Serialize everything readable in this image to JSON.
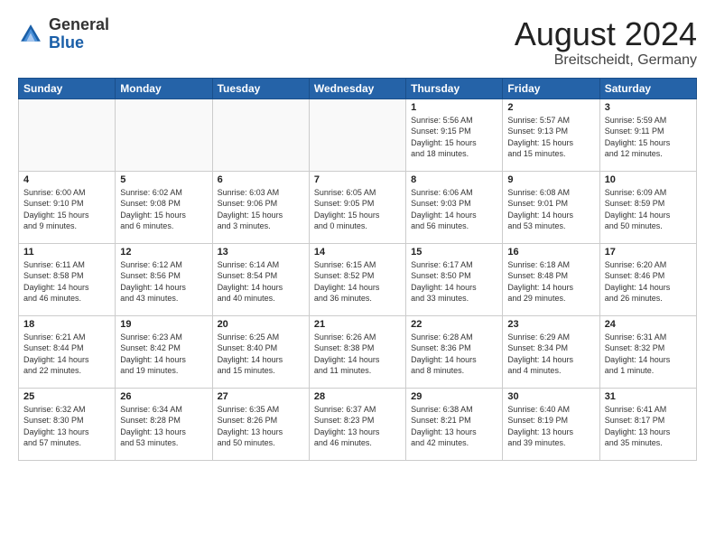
{
  "header": {
    "logo_general": "General",
    "logo_blue": "Blue",
    "month_year": "August 2024",
    "location": "Breitscheidt, Germany"
  },
  "days_of_week": [
    "Sunday",
    "Monday",
    "Tuesday",
    "Wednesday",
    "Thursday",
    "Friday",
    "Saturday"
  ],
  "weeks": [
    [
      {
        "day": "",
        "info": ""
      },
      {
        "day": "",
        "info": ""
      },
      {
        "day": "",
        "info": ""
      },
      {
        "day": "",
        "info": ""
      },
      {
        "day": "1",
        "info": "Sunrise: 5:56 AM\nSunset: 9:15 PM\nDaylight: 15 hours\nand 18 minutes."
      },
      {
        "day": "2",
        "info": "Sunrise: 5:57 AM\nSunset: 9:13 PM\nDaylight: 15 hours\nand 15 minutes."
      },
      {
        "day": "3",
        "info": "Sunrise: 5:59 AM\nSunset: 9:11 PM\nDaylight: 15 hours\nand 12 minutes."
      }
    ],
    [
      {
        "day": "4",
        "info": "Sunrise: 6:00 AM\nSunset: 9:10 PM\nDaylight: 15 hours\nand 9 minutes."
      },
      {
        "day": "5",
        "info": "Sunrise: 6:02 AM\nSunset: 9:08 PM\nDaylight: 15 hours\nand 6 minutes."
      },
      {
        "day": "6",
        "info": "Sunrise: 6:03 AM\nSunset: 9:06 PM\nDaylight: 15 hours\nand 3 minutes."
      },
      {
        "day": "7",
        "info": "Sunrise: 6:05 AM\nSunset: 9:05 PM\nDaylight: 15 hours\nand 0 minutes."
      },
      {
        "day": "8",
        "info": "Sunrise: 6:06 AM\nSunset: 9:03 PM\nDaylight: 14 hours\nand 56 minutes."
      },
      {
        "day": "9",
        "info": "Sunrise: 6:08 AM\nSunset: 9:01 PM\nDaylight: 14 hours\nand 53 minutes."
      },
      {
        "day": "10",
        "info": "Sunrise: 6:09 AM\nSunset: 8:59 PM\nDaylight: 14 hours\nand 50 minutes."
      }
    ],
    [
      {
        "day": "11",
        "info": "Sunrise: 6:11 AM\nSunset: 8:58 PM\nDaylight: 14 hours\nand 46 minutes."
      },
      {
        "day": "12",
        "info": "Sunrise: 6:12 AM\nSunset: 8:56 PM\nDaylight: 14 hours\nand 43 minutes."
      },
      {
        "day": "13",
        "info": "Sunrise: 6:14 AM\nSunset: 8:54 PM\nDaylight: 14 hours\nand 40 minutes."
      },
      {
        "day": "14",
        "info": "Sunrise: 6:15 AM\nSunset: 8:52 PM\nDaylight: 14 hours\nand 36 minutes."
      },
      {
        "day": "15",
        "info": "Sunrise: 6:17 AM\nSunset: 8:50 PM\nDaylight: 14 hours\nand 33 minutes."
      },
      {
        "day": "16",
        "info": "Sunrise: 6:18 AM\nSunset: 8:48 PM\nDaylight: 14 hours\nand 29 minutes."
      },
      {
        "day": "17",
        "info": "Sunrise: 6:20 AM\nSunset: 8:46 PM\nDaylight: 14 hours\nand 26 minutes."
      }
    ],
    [
      {
        "day": "18",
        "info": "Sunrise: 6:21 AM\nSunset: 8:44 PM\nDaylight: 14 hours\nand 22 minutes."
      },
      {
        "day": "19",
        "info": "Sunrise: 6:23 AM\nSunset: 8:42 PM\nDaylight: 14 hours\nand 19 minutes."
      },
      {
        "day": "20",
        "info": "Sunrise: 6:25 AM\nSunset: 8:40 PM\nDaylight: 14 hours\nand 15 minutes."
      },
      {
        "day": "21",
        "info": "Sunrise: 6:26 AM\nSunset: 8:38 PM\nDaylight: 14 hours\nand 11 minutes."
      },
      {
        "day": "22",
        "info": "Sunrise: 6:28 AM\nSunset: 8:36 PM\nDaylight: 14 hours\nand 8 minutes."
      },
      {
        "day": "23",
        "info": "Sunrise: 6:29 AM\nSunset: 8:34 PM\nDaylight: 14 hours\nand 4 minutes."
      },
      {
        "day": "24",
        "info": "Sunrise: 6:31 AM\nSunset: 8:32 PM\nDaylight: 14 hours\nand 1 minute."
      }
    ],
    [
      {
        "day": "25",
        "info": "Sunrise: 6:32 AM\nSunset: 8:30 PM\nDaylight: 13 hours\nand 57 minutes."
      },
      {
        "day": "26",
        "info": "Sunrise: 6:34 AM\nSunset: 8:28 PM\nDaylight: 13 hours\nand 53 minutes."
      },
      {
        "day": "27",
        "info": "Sunrise: 6:35 AM\nSunset: 8:26 PM\nDaylight: 13 hours\nand 50 minutes."
      },
      {
        "day": "28",
        "info": "Sunrise: 6:37 AM\nSunset: 8:23 PM\nDaylight: 13 hours\nand 46 minutes."
      },
      {
        "day": "29",
        "info": "Sunrise: 6:38 AM\nSunset: 8:21 PM\nDaylight: 13 hours\nand 42 minutes."
      },
      {
        "day": "30",
        "info": "Sunrise: 6:40 AM\nSunset: 8:19 PM\nDaylight: 13 hours\nand 39 minutes."
      },
      {
        "day": "31",
        "info": "Sunrise: 6:41 AM\nSunset: 8:17 PM\nDaylight: 13 hours\nand 35 minutes."
      }
    ]
  ]
}
